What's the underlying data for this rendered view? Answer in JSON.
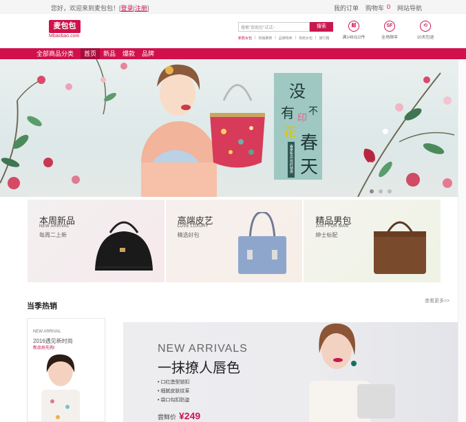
{
  "topbar": {
    "welcome": "您好，欢迎来到麦包包！[",
    "login": "登录",
    "sep": "|",
    "register": "注册",
    "close_bracket": "]",
    "my_orders": "我的订单",
    "cart": "购物车",
    "cart_count": "0",
    "site_nav": "网站导航"
  },
  "logo": {
    "mark": "麦包包",
    "sub": "Mbaobao.com"
  },
  "search": {
    "placeholder": "搜索\"双肩包\"试试~",
    "button": "搜索"
  },
  "hotwords": [
    "新款女包",
    "热销推荐",
    "品牌特卖",
    "单肩女包",
    "旅行箱"
  ],
  "services": [
    {
      "icon": "邮",
      "label": "满149元/2件"
    },
    {
      "icon": "SF",
      "label": "全场顺丰"
    },
    {
      "icon": "⟲",
      "label": "10天包退"
    }
  ],
  "nav": {
    "all": "全部商品分类",
    "items": [
      "首页",
      "新品",
      "爆款",
      "品牌"
    ]
  },
  "banner": {
    "headline_1": "没",
    "headline_2": "有",
    "headline_3": "印",
    "headline_4": "花",
    "headline_5": "不",
    "headline_6": "春",
    "headline_7": "天",
    "vertical_tag": "春季新品 限时特惠"
  },
  "promo": [
    {
      "title": "本周新品",
      "en": "NEW ARRIVAL",
      "sub": "每周二上新"
    },
    {
      "title": "高端皮艺",
      "en": "LOVE LUXURY",
      "sub": "精选好包"
    },
    {
      "title": "精品男包",
      "en": "JUST FOR MAN",
      "sub": "绅士标配"
    }
  ],
  "hot": {
    "title": "当季热销",
    "more": "查看更多>>"
  },
  "left_card": {
    "en": "NEW ARRIVAL",
    "year": "2016遇见新时尚",
    "first": "新品抢先购!"
  },
  "big_banner": {
    "en": "NEW ARRIVALS",
    "cn": "一抹撩人唇色",
    "features": [
      "口红造型锁扣",
      "细腻皮肤纹革",
      "袋口勾扣防盗"
    ],
    "price_label": "尝鲜价",
    "price": "¥249"
  },
  "colors": {
    "brand": "#d0114b"
  }
}
